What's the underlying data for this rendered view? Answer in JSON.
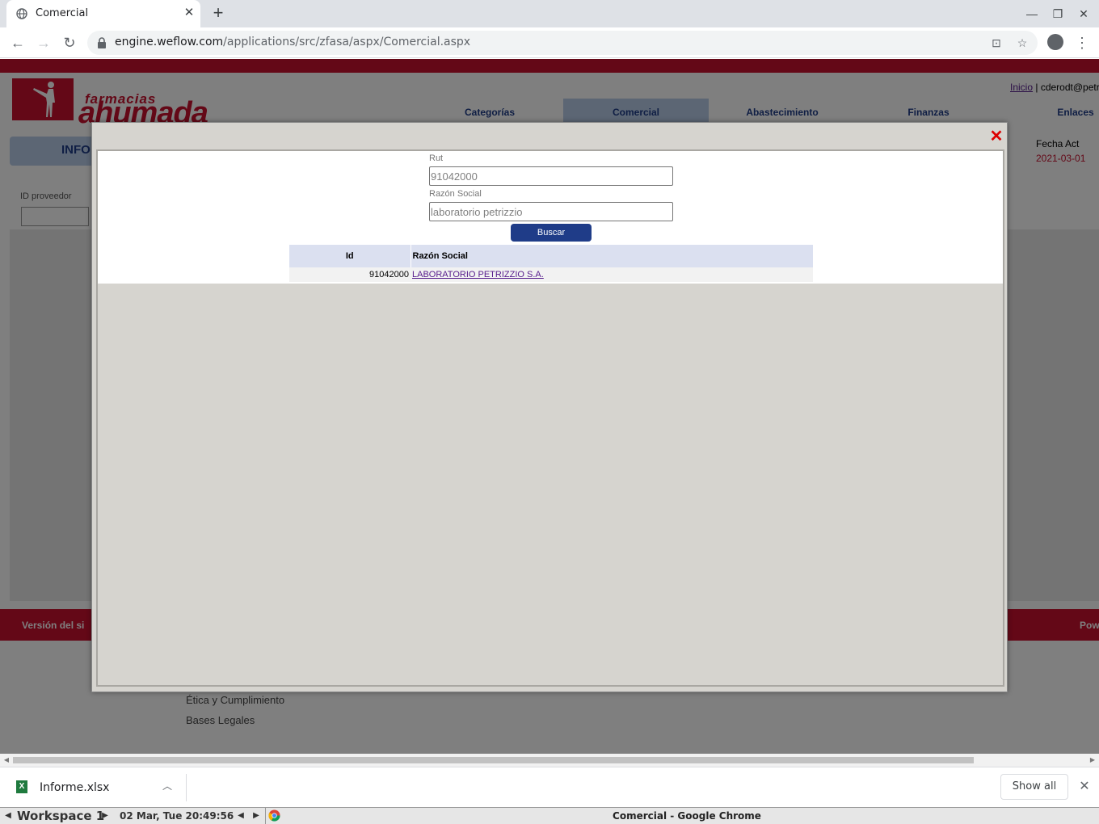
{
  "browser": {
    "tab_title": "Comercial",
    "url_host": "engine.weflow.com",
    "url_path": "/applications/src/zfasa/aspx/Comercial.aspx"
  },
  "site": {
    "logo_small": "farmacias",
    "logo_big": "ahumada",
    "top_links": {
      "inicio": "Inicio",
      "separator": " | ",
      "user": "cderodt@petr"
    },
    "nav": [
      "Categorías",
      "Comercial",
      "Abastecimiento",
      "Finanzas",
      "Enlaces"
    ],
    "active_nav": "Comercial",
    "sub_header": "INFO",
    "id_label": "ID proveedor",
    "fecha_label": "Fecha Act",
    "fecha_value": "2021-03-01",
    "footer_left": "Versión del si",
    "footer_right": "Pow",
    "footer_links": [
      "Ética y Cumplimiento",
      "Bases Legales"
    ]
  },
  "modal": {
    "close_symbol": "✕",
    "rut_label": "Rut",
    "rut_value": "91042000",
    "razon_label": "Razón Social",
    "razon_value": "laboratorio petrizzio",
    "search_button": "Buscar",
    "table": {
      "headers": [
        "Id",
        "Razón Social"
      ],
      "rows": [
        {
          "id": "91042000",
          "razon_social": "LABORATORIO PETRIZZIO S.A."
        }
      ]
    }
  },
  "downloads": {
    "file_name": "Informe.xlsx",
    "show_all": "Show all"
  },
  "taskbar": {
    "workspace": "Workspace 1",
    "clock": "02 Mar, Tue 20:49:56",
    "window_title": "Comercial - Google Chrome"
  },
  "colors": {
    "brand_red": "#c8102e",
    "nav_blue": "#1f3c88",
    "nav_active_bg": "#b8cde8",
    "table_header_bg": "#dbe0f0"
  }
}
